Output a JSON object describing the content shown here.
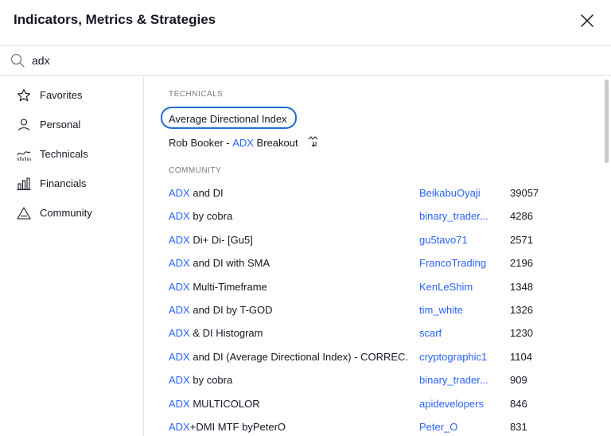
{
  "dialog": {
    "title": "Indicators, Metrics & Strategies"
  },
  "search": {
    "value": "adx",
    "placeholder": ""
  },
  "sidebar": {
    "items": [
      {
        "label": "Favorites",
        "icon": "star-icon"
      },
      {
        "label": "Personal",
        "icon": "user-icon"
      },
      {
        "label": "Technicals",
        "icon": "chart-line-icon"
      },
      {
        "label": "Financials",
        "icon": "bar-chart-icon"
      },
      {
        "label": "Community",
        "icon": "triangle-icon"
      }
    ]
  },
  "technicals": {
    "heading": "TECHNICALS",
    "items": [
      {
        "label": "Average Directional Index"
      },
      {
        "prefix": "Rob Booker - ",
        "keyword": "ADX",
        "suffix": " Breakout",
        "icon": "strategy-icon"
      }
    ]
  },
  "community": {
    "heading": "COMMUNITY",
    "items": [
      {
        "keyword": "ADX",
        "rest": " and DI",
        "author": "BeikabuOyaji",
        "count": "39057"
      },
      {
        "keyword": "ADX",
        "rest": " by cobra",
        "author": "binary_trader...",
        "count": "4286"
      },
      {
        "keyword": "ADX",
        "rest": " Di+ Di- [Gu5]",
        "author": "gu5tavo71",
        "count": "2571"
      },
      {
        "keyword": "ADX",
        "rest": " and DI with SMA",
        "author": "FrancoTrading",
        "count": "2196"
      },
      {
        "keyword": "ADX",
        "rest": " Multi-Timeframe",
        "author": "KenLeShim",
        "count": "1348"
      },
      {
        "keyword": "ADX",
        "rest": " and DI by T-GOD",
        "author": "tim_white",
        "count": "1326"
      },
      {
        "keyword": "ADX",
        "rest": " & DI Histogram",
        "author": "scarf",
        "count": "1230"
      },
      {
        "keyword": "ADX",
        "rest": " and DI (Average Directional Index) - CORREC...",
        "author": "cryptographic1",
        "count": "1104"
      },
      {
        "keyword": "ADX",
        "rest": " by cobra",
        "author": "binary_trader...",
        "count": "909"
      },
      {
        "keyword": "ADX",
        "rest": " MULTICOLOR",
        "author": "apidevelopers",
        "count": "846"
      },
      {
        "keyword": "ADX",
        "rest": "+DMI MTF byPeterO",
        "author": "Peter_O",
        "count": "831"
      }
    ]
  },
  "colors": {
    "accent": "#2962ff",
    "highlight_ring": "#1e6bd6",
    "text": "#131722",
    "muted": "#787b86"
  }
}
